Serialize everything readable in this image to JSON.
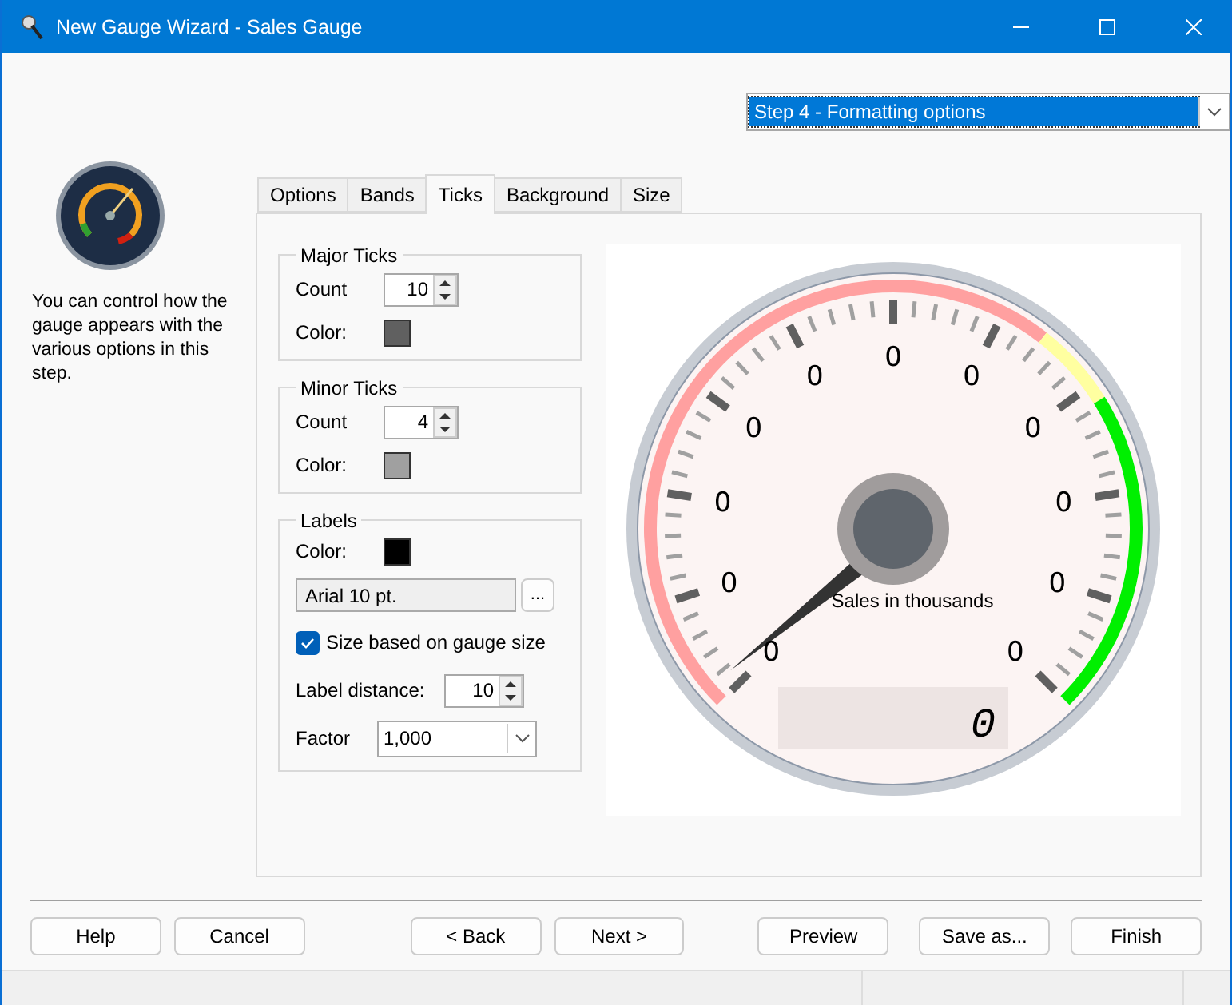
{
  "window": {
    "title": "New Gauge Wizard - Sales Gauge"
  },
  "step_selector": {
    "value": "Step 4 - Formatting options"
  },
  "description": "You can control how the gauge appears with the various options in this step.",
  "tabs": [
    {
      "label": "Options",
      "selected": false
    },
    {
      "label": "Bands",
      "selected": false
    },
    {
      "label": "Ticks",
      "selected": true
    },
    {
      "label": "Background",
      "selected": false
    },
    {
      "label": "Size",
      "selected": false
    }
  ],
  "major_ticks": {
    "title": "Major Ticks",
    "count_label": "Count",
    "count": "10",
    "color_label": "Color:",
    "color": "#606060"
  },
  "minor_ticks": {
    "title": "Minor Ticks",
    "count_label": "Count",
    "count": "4",
    "color_label": "Color:",
    "color": "#a0a0a0"
  },
  "labels": {
    "title": "Labels",
    "color_label": "Color:",
    "color": "#000000",
    "font": "Arial 10 pt.",
    "font_button": "...",
    "size_based": {
      "label": "Size based on gauge size",
      "checked": true
    },
    "distance_label": "Label distance:",
    "distance": "10",
    "factor_label": "Factor",
    "factor": "1,000"
  },
  "preview": {
    "scale_labels": [
      "0",
      "0",
      "0",
      "0",
      "0",
      "0",
      "0",
      "0",
      "0",
      "0",
      "0"
    ],
    "caption": "Sales in thousands",
    "readout": "0"
  },
  "buttons": [
    "Help",
    "Cancel",
    "< Back",
    "Next >",
    "Preview",
    "Save as...",
    "Finish"
  ]
}
